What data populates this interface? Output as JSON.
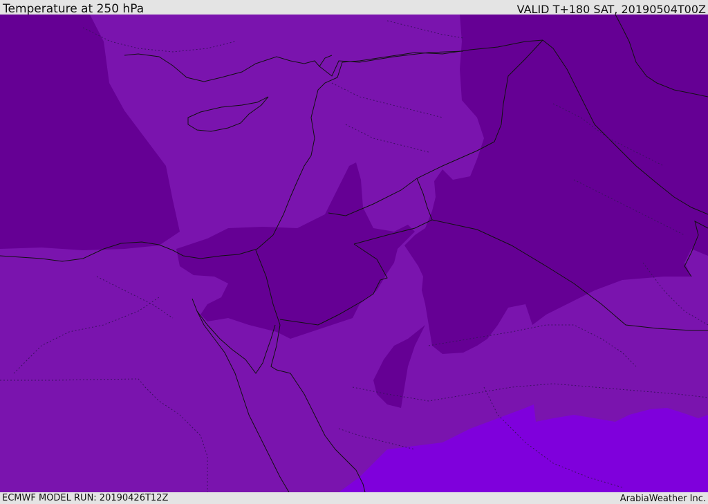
{
  "header": {
    "title": "Temperature at 250 hPa",
    "valid_time": "VALID T+180 SAT, 20190504T00Z"
  },
  "footer": {
    "model_run": "ECMWF MODEL RUN: 20190426T12Z",
    "credit": "ArabiaWeather Inc."
  },
  "map": {
    "field": "Temperature at 250 hPa",
    "colors": {
      "background": "#7a14ae",
      "cold_band": "#650094",
      "warm_region": "#7f00dc",
      "coastline": "#111111",
      "border": "#111111",
      "region_boundary": "#3a1060",
      "frame": "#e4e4e4"
    }
  }
}
